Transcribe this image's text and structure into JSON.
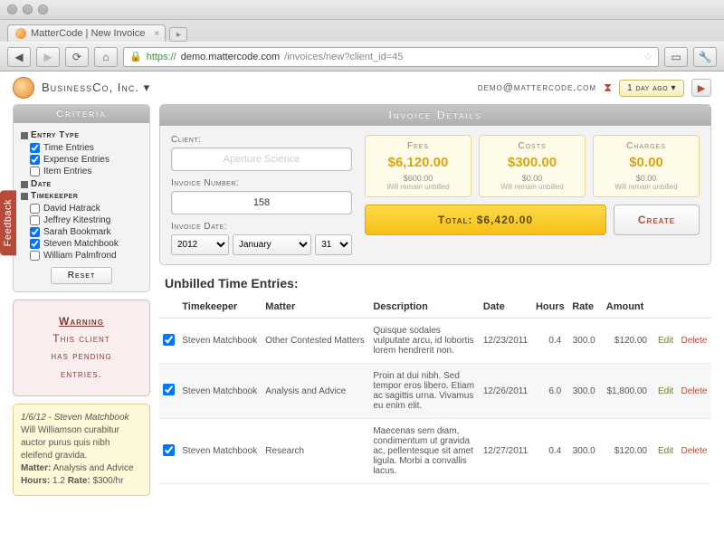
{
  "browser": {
    "tab_title": "MatterCode | New Invoice",
    "url_host": "https://",
    "url_domain": "demo.mattercode.com",
    "url_path": "/invoices/new?client_id=45"
  },
  "appbar": {
    "company": "BusinessCo, Inc. ▾",
    "email": "demo@mattercode.com",
    "time_btn": "1 day ago ▾"
  },
  "feedback_tab": "Feedback",
  "criteria": {
    "title": "Criteria",
    "entry_type_label": "Entry Type",
    "entry_types": [
      {
        "label": "Time Entries",
        "checked": true
      },
      {
        "label": "Expense Entries",
        "checked": true
      },
      {
        "label": "Item Entries",
        "checked": false
      }
    ],
    "date_label": "Date",
    "timekeeper_label": "Timekeeper",
    "timekeepers": [
      {
        "label": "David Hatrack",
        "checked": false
      },
      {
        "label": "Jeffrey Kitestring",
        "checked": false
      },
      {
        "label": "Sarah Bookmark",
        "checked": true
      },
      {
        "label": "Steven Matchbook",
        "checked": true
      },
      {
        "label": "William Palmfrond",
        "checked": false
      }
    ],
    "reset": "Reset"
  },
  "warning": {
    "line1": "Warning",
    "line2": "This client",
    "line3": "has pending",
    "line4": "entries."
  },
  "note": {
    "header": "1/6/12 - Steven Matchbook",
    "body": "Will Williamson curabitur auctor purus quis nibh eleifend gravida.",
    "matter_l": "Matter:",
    "matter_v": "Analysis and Advice",
    "hours_l": "Hours:",
    "hours_v": "1.2",
    "rate_l": "Rate:",
    "rate_v": "$300/hr"
  },
  "details": {
    "title": "Invoice Details",
    "client_l": "Client:",
    "client_ph": "Aperture Science",
    "invno_l": "Invoice Number:",
    "invno_v": "158",
    "invdate_l": "Invoice Date:",
    "year": "2012",
    "month": "January",
    "day": "31",
    "summary": [
      {
        "t": "Fees",
        "v": "$6,120.00",
        "s": "$600.00",
        "s2": "Will remain unbilled"
      },
      {
        "t": "Costs",
        "v": "$300.00",
        "s": "$0.00",
        "s2": "Will remain unbilled"
      },
      {
        "t": "Charges",
        "v": "$0.00",
        "s": "$0.00",
        "s2": "Will remain unbilled"
      }
    ],
    "total_l": "Total: ",
    "total_v": "$6,420.00",
    "create": "Create"
  },
  "table": {
    "title": "Unbilled Time Entries:",
    "headers": [
      "",
      "Timekeeper",
      "Matter",
      "Description",
      "Date",
      "Hours",
      "Rate",
      "Amount",
      "",
      ""
    ],
    "edit": "Edit",
    "delete": "Delete",
    "rows": [
      {
        "tk": "Steven Matchbook",
        "matter": "Other Contested Matters",
        "desc": "Quisque sodales vulputate arcu, id lobortis lorem hendrerit non.",
        "date": "12/23/2011",
        "hours": "0.4",
        "rate": "300.0",
        "amount": "$120.00"
      },
      {
        "tk": "Steven Matchbook",
        "matter": "Analysis and Advice",
        "desc": "Proin at dui nibh. Sed tempor eros libero. Etiam ac sagittis urna. Vivamus eu enim elit.",
        "date": "12/26/2011",
        "hours": "6.0",
        "rate": "300.0",
        "amount": "$1,800.00"
      },
      {
        "tk": "Steven Matchbook",
        "matter": "Research",
        "desc": "Maecenas sem diam, condimentum ut gravida ac, pellentesque sit amet ligula. Morbi a convallis lacus.",
        "date": "12/27/2011",
        "hours": "0.4",
        "rate": "300.0",
        "amount": "$120.00"
      }
    ]
  }
}
